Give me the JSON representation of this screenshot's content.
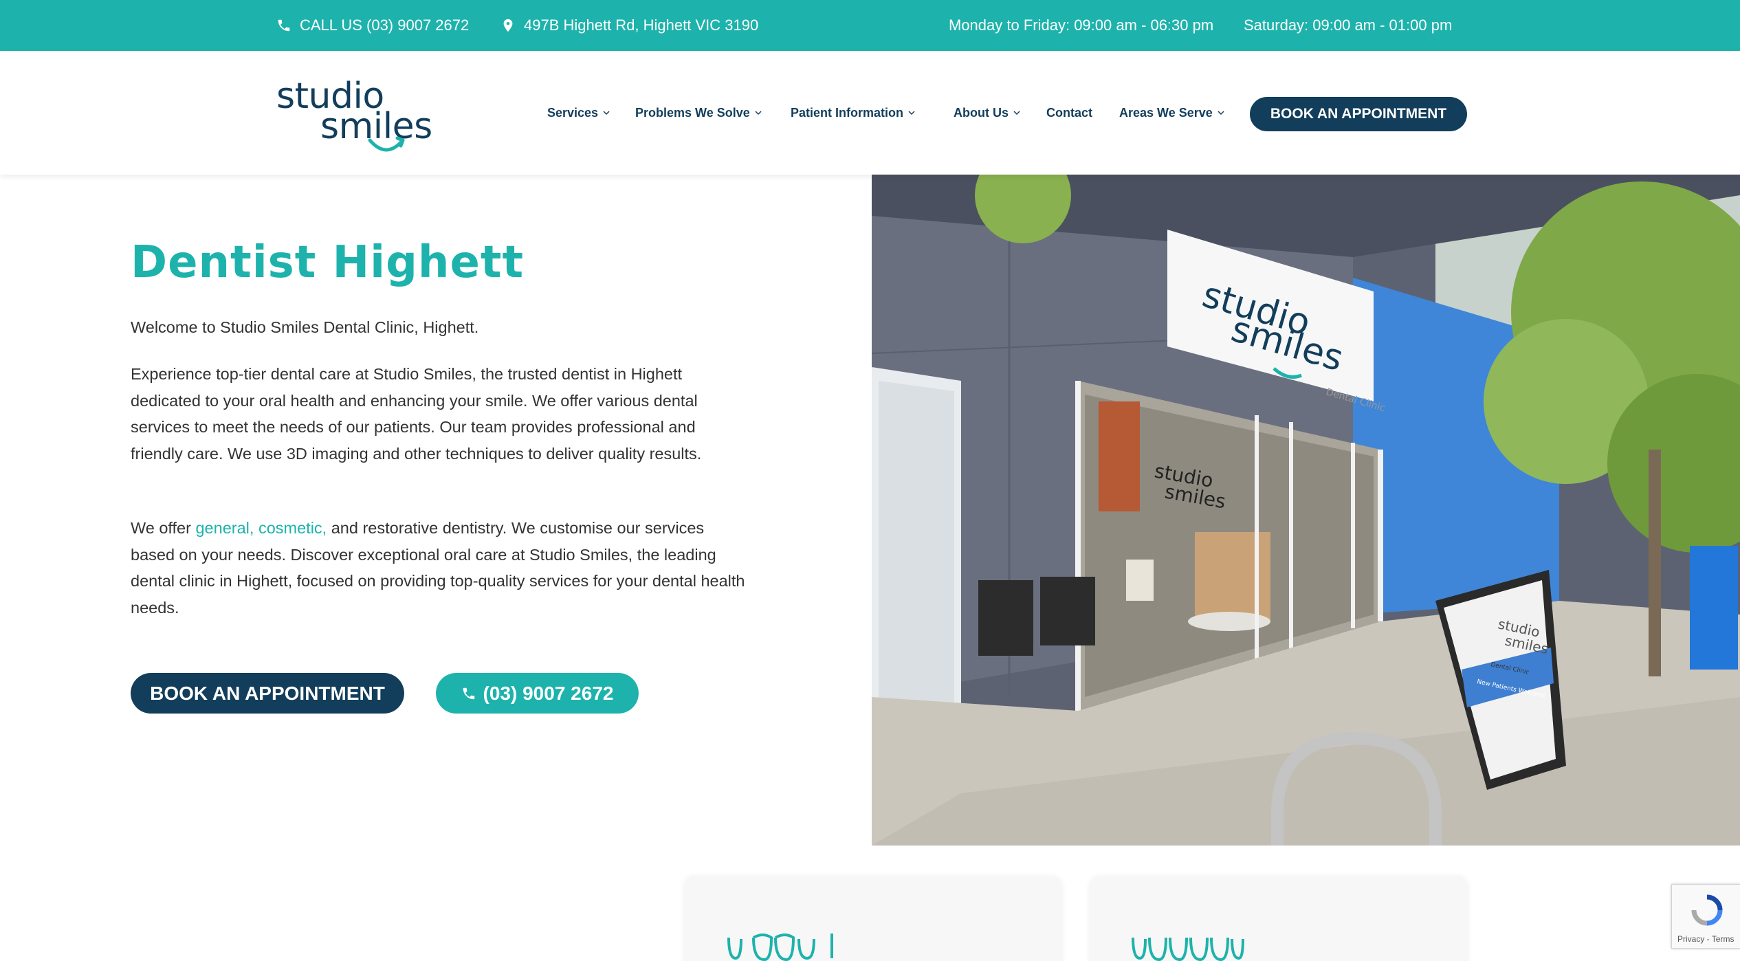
{
  "topbar": {
    "phone": "CALL US (03) 9007 2672",
    "address": "497B Highett Rd, Highett VIC 3190",
    "hours_weekday": "Monday to Friday: 09:00 am - 06:30 pm",
    "hours_saturday": "Saturday: 09:00 am - 01:00 pm"
  },
  "logo": {
    "line1": "studio",
    "line2": "smiles"
  },
  "nav": {
    "items": [
      {
        "label": "Services",
        "dropdown": true
      },
      {
        "label": "Problems We Solve",
        "dropdown": true
      },
      {
        "label": "Patient Information",
        "dropdown": true
      },
      {
        "label": "About Us",
        "dropdown": true
      },
      {
        "label": "Contact",
        "dropdown": false
      },
      {
        "label": "Areas We Serve",
        "dropdown": true
      }
    ],
    "cta": "BOOK AN APPOINTMENT"
  },
  "hero": {
    "title": "Dentist Highett",
    "intro": "Welcome to Studio Smiles Dental Clinic, Highett.",
    "body": "Experience top-tier dental care at Studio Smiles, the trusted dentist in Highett dedicated to your oral health and enhancing your smile. We offer various dental services to meet the needs of our patients. Our team provides professional and friendly care. We use 3D imaging and other techniques to deliver quality results.",
    "offer_prefix": "We offer ",
    "offer_link_general": "general,",
    "offer_link_cosmetic": "cosmetic,",
    "offer_suffix": " and restorative dentistry. We customise our services based on your needs. Discover exceptional oral care at Studio Smiles, the leading dental clinic in Highett, focused on providing top-quality services for your dental health needs.",
    "book_button": "BOOK AN APPOINTMENT",
    "phone_button": "(03) 9007 2672"
  },
  "photo": {
    "sign_line1": "studio",
    "sign_line2": "smiles",
    "sign_sub": "Dental Clinic",
    "board_line1": "studio",
    "board_line2": "smiles",
    "board_text": "Dental Clinic",
    "board_welcome": "New Patients Welcome"
  },
  "recaptcha": {
    "terms": "Privacy - Terms"
  },
  "colors": {
    "teal": "#1db3ac",
    "navy": "#123e5b"
  }
}
